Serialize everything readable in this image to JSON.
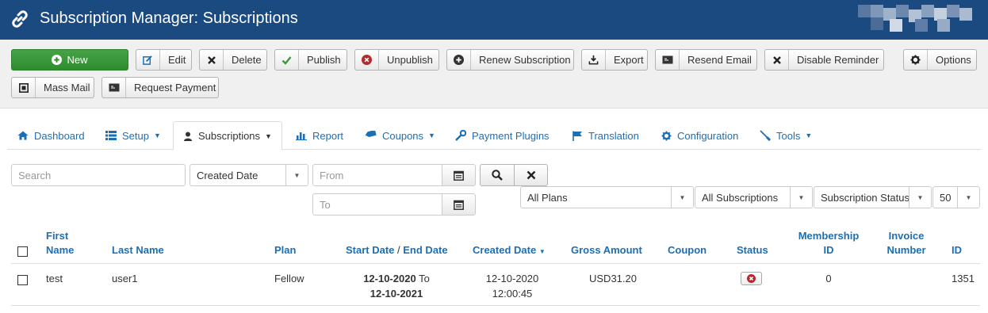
{
  "header": {
    "title": "Subscription Manager: Subscriptions",
    "icon": "link-icon"
  },
  "toolbar": {
    "new_label": "New",
    "edit_label": "Edit",
    "delete_label": "Delete",
    "publish_label": "Publish",
    "unpublish_label": "Unpublish",
    "renew_label": "Renew Subscription",
    "export_label": "Export",
    "resend_label": "Resend Email",
    "disable_reminder_label": "Disable Reminder",
    "options_label": "Options",
    "mass_mail_label": "Mass Mail",
    "request_payment_label": "Request Payment"
  },
  "tabs": {
    "dashboard": "Dashboard",
    "setup": "Setup",
    "subscriptions": "Subscriptions",
    "report": "Report",
    "coupons": "Coupons",
    "payment_plugins": "Payment Plugins",
    "translation": "Translation",
    "configuration": "Configuration",
    "tools": "Tools"
  },
  "filters": {
    "search_placeholder": "Search",
    "date_field": "Created Date",
    "from_placeholder": "From",
    "to_placeholder": "To",
    "plan": "All Plans",
    "subscription_type": "All Subscriptions",
    "status": "Subscription Status",
    "limit": "50"
  },
  "table": {
    "headers": {
      "first_name_1": "First",
      "first_name_2": "Name",
      "last_name": "Last Name",
      "plan": "Plan",
      "start_date": "Start Date",
      "separator": " / ",
      "end_date": "End Date",
      "created_date": "Created Date",
      "gross_amount": "Gross Amount",
      "coupon": "Coupon",
      "status": "Status",
      "membership_1": "Membership",
      "membership_2": "ID",
      "invoice_1": "Invoice",
      "invoice_2": "Number",
      "id": "ID"
    },
    "rows": [
      {
        "first_name": "test",
        "last_name": "user1",
        "plan": "Fellow",
        "start_date": "12-10-2020",
        "to_word": " To",
        "end_date": "12-10-2021",
        "created_date": "12-10-2020",
        "created_time": "12:00:45",
        "gross_amount": "USD31.20",
        "coupon": "",
        "status_icon": "unpublished-x-icon",
        "membership_id": "0",
        "invoice_number": "",
        "id": "1351"
      }
    ]
  },
  "colors": {
    "header_bg": "#1a4a80",
    "new_button": "#3a993a",
    "link": "#1b6fb5",
    "unpublish_red": "#b52a2a"
  }
}
